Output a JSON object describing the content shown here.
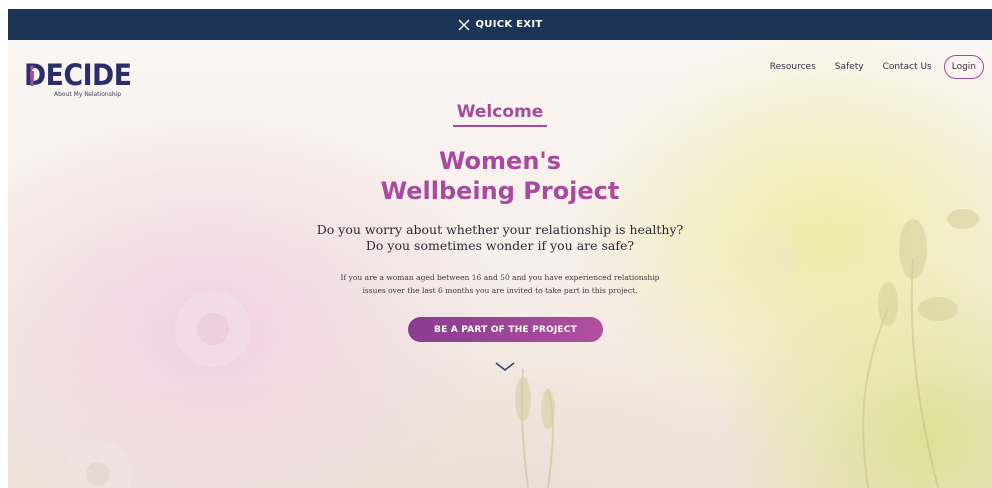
{
  "quick_exit": {
    "label": "QUICK EXIT",
    "icon": "close-icon"
  },
  "logo": {
    "word": "DECIDE",
    "tagline": "About My Relationship"
  },
  "nav": {
    "items": [
      {
        "label": "Resources"
      },
      {
        "label": "Safety"
      },
      {
        "label": "Contact Us"
      }
    ],
    "login_label": "Login"
  },
  "hero": {
    "welcome": "Welcome",
    "title_line1": "Women's",
    "title_line2": "Wellbeing Project",
    "question_line1": "Do you worry about whether your relationship is healthy?",
    "question_line2": "Do you sometimes wonder if you are safe?",
    "invitation_line1": "If you are a woman aged between 16 and 50 and you have experienced relationship",
    "invitation_line2": "issues over the last 6 months you are invited to take part in this project.",
    "cta_label": "BE A PART OF THE PROJECT",
    "scroll_icon": "chevron-down-icon"
  },
  "colors": {
    "header_bar": "#1c3557",
    "accent": "#a84a9e",
    "logo": "#2a2e6a"
  }
}
